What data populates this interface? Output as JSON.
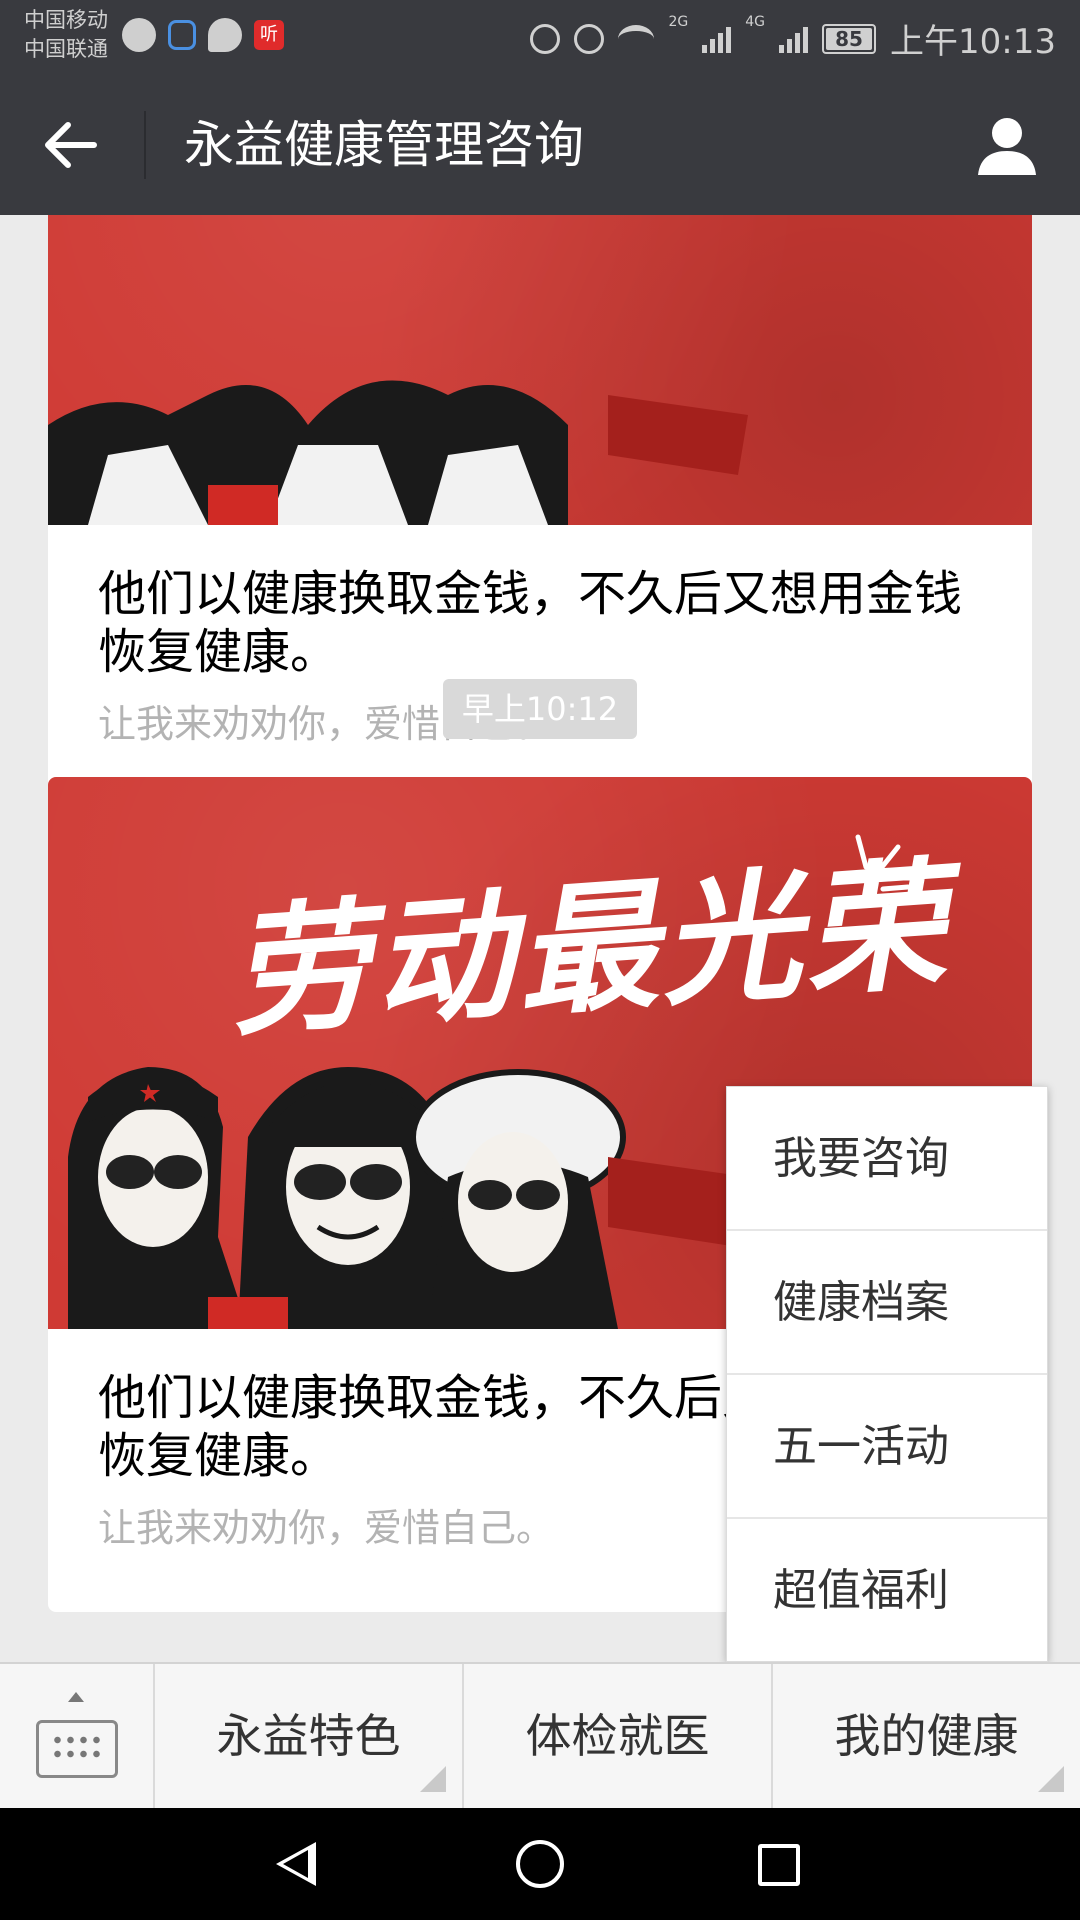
{
  "status_bar": {
    "carrier_1": "中国移动",
    "carrier_2": "中国联通",
    "ting_icon_label": "听",
    "network_1": "2G",
    "network_2": "4G",
    "battery": "85",
    "time": "上午10:13"
  },
  "header": {
    "title": "永益健康管理咨询",
    "back_icon": "arrow-left-icon",
    "profile_icon": "user-icon"
  },
  "messages": [
    {
      "headline": "他们以健康换取金钱，不久后又想用金钱恢复健康。",
      "description": "让我来劝劝你，爱惜自己。"
    },
    {
      "cover_text": "劳动最光荣",
      "headline": "他们以健康换取金钱，不久后又想用金钱恢复健康。",
      "description": "让我来劝劝你，爱惜自己。"
    }
  ],
  "time_badge": "早上10:12",
  "popup_menu": {
    "items": [
      "我要咨询",
      "健康档案",
      "五一活动",
      "超值福利"
    ]
  },
  "bottom_menu": {
    "keyboard_icon": "keyboard-icon",
    "items": [
      "永益特色",
      "体检就医",
      "我的健康"
    ]
  },
  "colors": {
    "title_bar": "#393a3f",
    "cover_red": "#cf3a34",
    "background": "#ebebeb"
  }
}
